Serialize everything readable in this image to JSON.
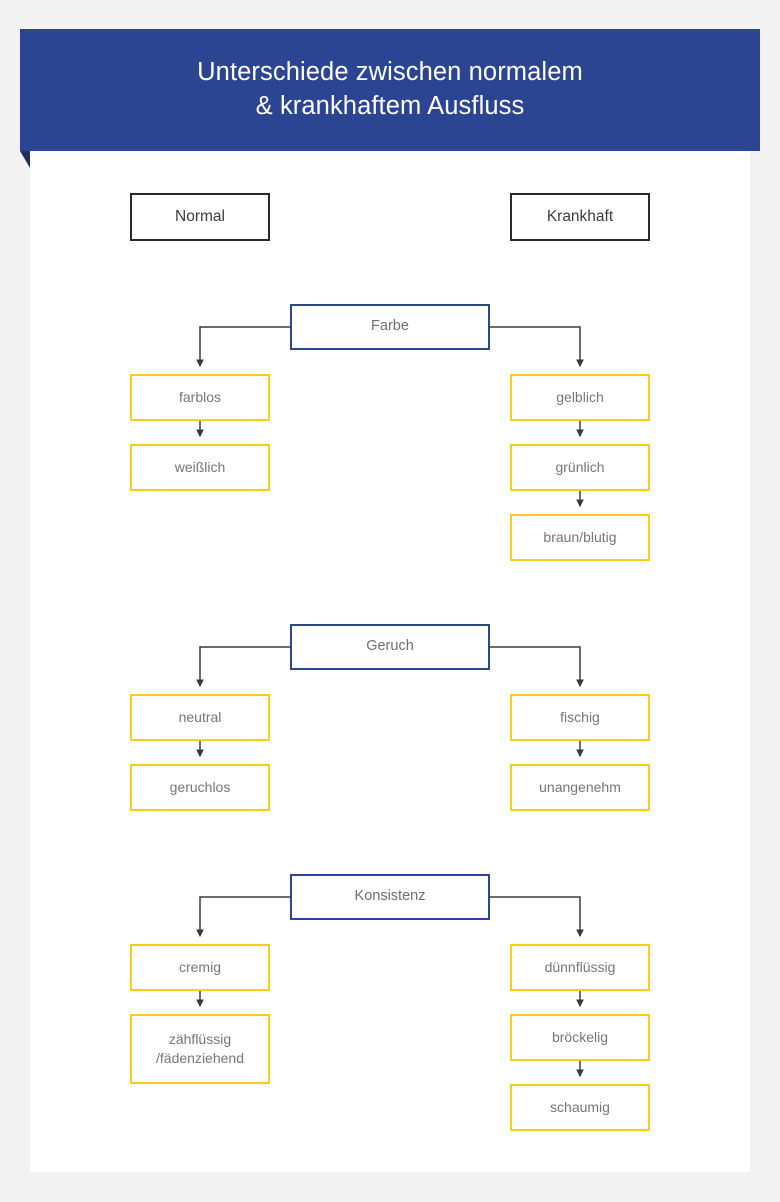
{
  "colors": {
    "page_background": "#f2f2f2",
    "banner": "#2c4593",
    "banner_fold": "#1f2f66",
    "card": "#ffffff",
    "head_border": "#2b2b2b",
    "category_border": "#2c4593",
    "value_border": "#fbcd16",
    "connector": "#3a3a3a",
    "title_text": "#ffffff",
    "label_text": "#767676"
  },
  "header": {
    "title": "Unterschiede zwischen normalem\n& krankhaftem Ausfluss",
    "title_line_1": "Unterschiede zwischen normalem",
    "title_line_2": "& krankhaftem Ausfluss"
  },
  "columns": {
    "left": "Normal",
    "right": "Krankhaft"
  },
  "sections": [
    {
      "category": "Farbe",
      "normal": [
        "farblos",
        "weißlich"
      ],
      "krankhaft": [
        "gelblich",
        "grünlich",
        "braun/blutig"
      ]
    },
    {
      "category": "Geruch",
      "normal": [
        "neutral",
        "geruchlos"
      ],
      "krankhaft": [
        "fischig",
        "unangenehm"
      ]
    },
    {
      "category": "Konsistenz",
      "normal": [
        "cremig",
        "zähflüssig\n/fädenziehend"
      ],
      "krankhaft": [
        "dünnflüssig",
        "bröckelig",
        "schaumig"
      ]
    }
  ],
  "nodes": {
    "head_normal": "Normal",
    "head_krankhaft": "Krankhaft",
    "farbe": "Farbe",
    "farblos": "farblos",
    "weisslich": "weißlich",
    "gelblich": "gelblich",
    "gruenlich": "grünlich",
    "braun_blutig": "braun/blutig",
    "geruch": "Geruch",
    "neutral": "neutral",
    "geruchlos": "geruchlos",
    "fischig": "fischig",
    "unangenehm": "unangenehm",
    "konsistenz": "Konsistenz",
    "cremig": "cremig",
    "zaehfluessig": "zähflüssig\n/fädenziehend",
    "duennfluessig": "dünnflüssig",
    "broeckelig": "bröckelig",
    "schaumig": "schaumig"
  }
}
